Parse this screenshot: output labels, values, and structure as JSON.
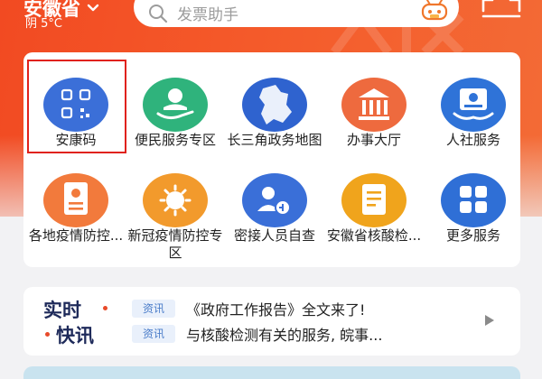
{
  "header": {
    "location": "安徽省",
    "weather": "阴 5°C",
    "search_placeholder": "发票助手"
  },
  "services": [
    {
      "label": "安康码",
      "icon": "qr-code-icon"
    },
    {
      "label": "便民服务专区",
      "icon": "service-hand-icon"
    },
    {
      "label": "长三角政务地图",
      "icon": "map-icon"
    },
    {
      "label": "办事大厅",
      "icon": "hall-building-icon"
    },
    {
      "label": "人社服务",
      "icon": "social-security-card-icon"
    },
    {
      "label": "各地疫情防控...",
      "icon": "epidemic-document-icon"
    },
    {
      "label": "新冠疫情防控专区",
      "icon": "virus-icon"
    },
    {
      "label": "密接人员自查",
      "icon": "contacts-icon"
    },
    {
      "label": "安徽省核酸检...",
      "icon": "test-report-icon"
    },
    {
      "label": "更多服务",
      "icon": "grid-more-icon"
    }
  ],
  "news": {
    "title_line1": "实时",
    "title_line2": "快讯",
    "items": [
      {
        "tag": "资讯",
        "text": "《政府工作报告》全文来了!"
      },
      {
        "tag": "资讯",
        "text": "与核酸检测有关的服务, 皖事..."
      }
    ]
  },
  "colors": {
    "brand": "#f24a22",
    "highlight_border": "#e0221b"
  }
}
